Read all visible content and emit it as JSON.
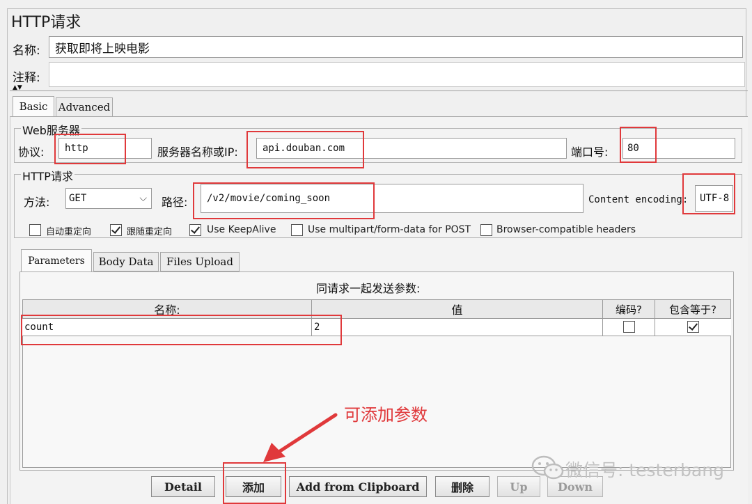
{
  "panel": {
    "title": "HTTP请求",
    "name_label": "名称:",
    "name_value": "获取即将上映电影",
    "comment_label": "注释:",
    "comment_value": ""
  },
  "tabs": [
    {
      "label": "Basic",
      "active": true
    },
    {
      "label": "Advanced",
      "active": false
    }
  ],
  "web_server": {
    "legend": "Web服务器",
    "protocol_label": "协议:",
    "protocol_value": "http",
    "server_label": "服务器名称或IP:",
    "server_value": "api.douban.com",
    "port_label": "端口号:",
    "port_value": "80"
  },
  "http_request": {
    "legend": "HTTP请求",
    "method_label": "方法:",
    "method_value": "GET",
    "path_label": "路径:",
    "path_value": "/v2/movie/coming_soon",
    "encoding_label": "Content encoding:",
    "encoding_value": "UTF-8"
  },
  "options": [
    {
      "label": "自动重定向",
      "checked": false
    },
    {
      "label": "跟随重定向",
      "checked": true
    },
    {
      "label": "Use KeepAlive",
      "checked": true
    },
    {
      "label": "Use multipart/form-data for POST",
      "checked": false
    },
    {
      "label": "Browser-compatible headers",
      "checked": false
    }
  ],
  "sub_tabs": [
    {
      "label": "Parameters",
      "active": true
    },
    {
      "label": "Body Data",
      "active": false
    },
    {
      "label": "Files Upload",
      "active": false
    }
  ],
  "params": {
    "caption": "同请求一起发送参数:",
    "columns": [
      "名称:",
      "值",
      "编码?",
      "包含等于?"
    ],
    "rows": [
      {
        "name": "count",
        "value": "2",
        "encode": false,
        "include_equals": true
      }
    ]
  },
  "annotation": {
    "text": "可添加参数",
    "color": "#e0393b"
  },
  "buttons": [
    {
      "label": "Detail",
      "enabled": true
    },
    {
      "label": "添加",
      "enabled": true
    },
    {
      "label": "Add from Clipboard",
      "enabled": true
    },
    {
      "label": "删除",
      "enabled": true
    },
    {
      "label": "Up",
      "enabled": false
    },
    {
      "label": "Down",
      "enabled": false
    }
  ],
  "watermark": {
    "text": "微信号: testerbang",
    "icon": "wechat-icon"
  }
}
